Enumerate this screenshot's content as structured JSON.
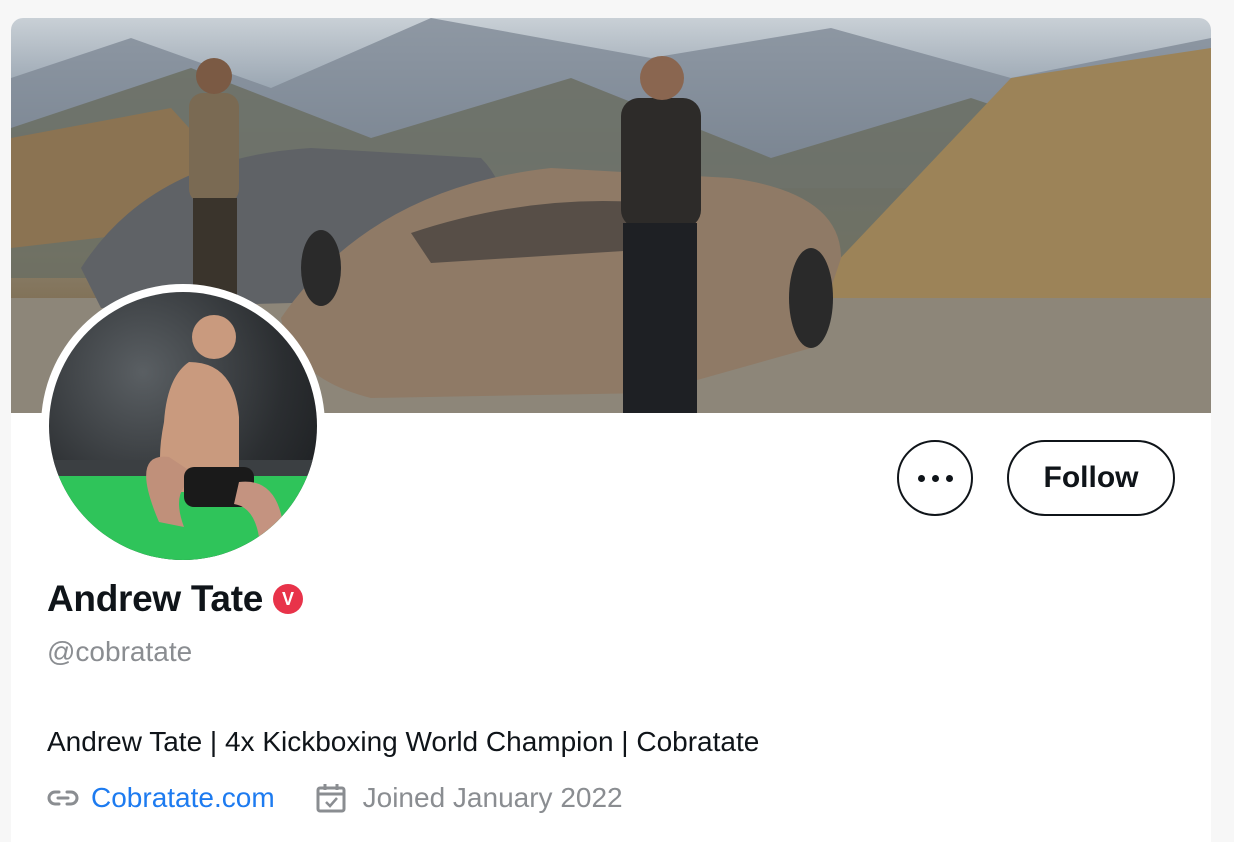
{
  "profile": {
    "name": "Andrew Tate",
    "verified_badge": "V",
    "handle": "@cobratate",
    "bio": "Andrew Tate | 4x Kickboxing World Champion | Cobratate",
    "website": "Cobratate.com",
    "joined": "Joined January 2022"
  },
  "actions": {
    "follow_label": "Follow",
    "more_icon": "ellipsis-icon"
  },
  "icons": {
    "link": "link-icon",
    "calendar": "calendar-icon"
  },
  "colors": {
    "link": "#1d7bf0",
    "verified_badge": "#e8334a",
    "muted_text": "#8a8d91"
  }
}
